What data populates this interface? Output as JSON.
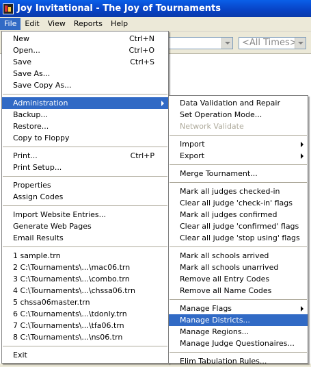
{
  "window": {
    "title": "Joy Invitational - The Joy of Tournaments"
  },
  "menubar": {
    "items": [
      "File",
      "Edit",
      "View",
      "Reports",
      "Help"
    ]
  },
  "toolbar": {
    "times_combo": "<All Times>"
  },
  "file_menu": {
    "items": [
      {
        "label": "New",
        "shortcut": "Ctrl+N"
      },
      {
        "label": "Open...",
        "shortcut": "Ctrl+O"
      },
      {
        "label": "Save",
        "shortcut": "Ctrl+S"
      },
      {
        "label": "Save As..."
      },
      {
        "label": "Save Copy As..."
      },
      {
        "sep": true
      },
      {
        "label": "Administration",
        "submenu": true,
        "highlighted": true
      },
      {
        "label": "Backup..."
      },
      {
        "label": "Restore..."
      },
      {
        "label": "Copy to Floppy"
      },
      {
        "sep": true
      },
      {
        "label": "Print...",
        "shortcut": "Ctrl+P"
      },
      {
        "label": "Print Setup..."
      },
      {
        "sep": true
      },
      {
        "label": "Properties"
      },
      {
        "label": "Assign Codes"
      },
      {
        "sep": true
      },
      {
        "label": "Import Website Entries..."
      },
      {
        "label": "Generate Web Pages"
      },
      {
        "label": "Email Results"
      },
      {
        "sep": true
      },
      {
        "label": "1 sample.trn"
      },
      {
        "label": "2 C:\\Tournaments\\...\\mac06.trn"
      },
      {
        "label": "3 C:\\Tournaments\\...\\combo.trn"
      },
      {
        "label": "4 C:\\Tournaments\\...\\chssa06.trn"
      },
      {
        "label": "5 chssa06master.trn"
      },
      {
        "label": "6 C:\\Tournaments\\...\\tdonly.trn"
      },
      {
        "label": "7 C:\\Tournaments\\...\\tfa06.trn"
      },
      {
        "label": "8 C:\\Tournaments\\...\\ns06.trn"
      },
      {
        "sep": true
      },
      {
        "label": "Exit"
      }
    ]
  },
  "admin_menu": {
    "items": [
      {
        "label": "Data Validation and Repair"
      },
      {
        "label": "Set Operation Mode..."
      },
      {
        "label": "Network Validate",
        "disabled": true
      },
      {
        "sep": true
      },
      {
        "label": "Import",
        "submenu": true
      },
      {
        "label": "Export",
        "submenu": true
      },
      {
        "sep": true
      },
      {
        "label": "Merge Tournament..."
      },
      {
        "sep": true
      },
      {
        "label": "Mark all judges checked-in"
      },
      {
        "label": "Clear all judge 'check-in' flags"
      },
      {
        "label": "Mark all judges confirmed"
      },
      {
        "label": "Clear all judge 'confirmed' flags"
      },
      {
        "label": "Clear all judge 'stop using' flags"
      },
      {
        "sep": true
      },
      {
        "label": "Mark all schools arrived"
      },
      {
        "label": "Mark all schools unarrived"
      },
      {
        "label": "Remove all Entry Codes"
      },
      {
        "label": "Remove all Name Codes"
      },
      {
        "sep": true
      },
      {
        "label": "Manage Flags",
        "submenu": true
      },
      {
        "label": "Manage Districts...",
        "highlighted": true
      },
      {
        "label": "Manage Regions..."
      },
      {
        "label": "Manage Judge Questionaires..."
      },
      {
        "sep": true
      },
      {
        "label": "Elim Tabulation Rules..."
      }
    ]
  }
}
